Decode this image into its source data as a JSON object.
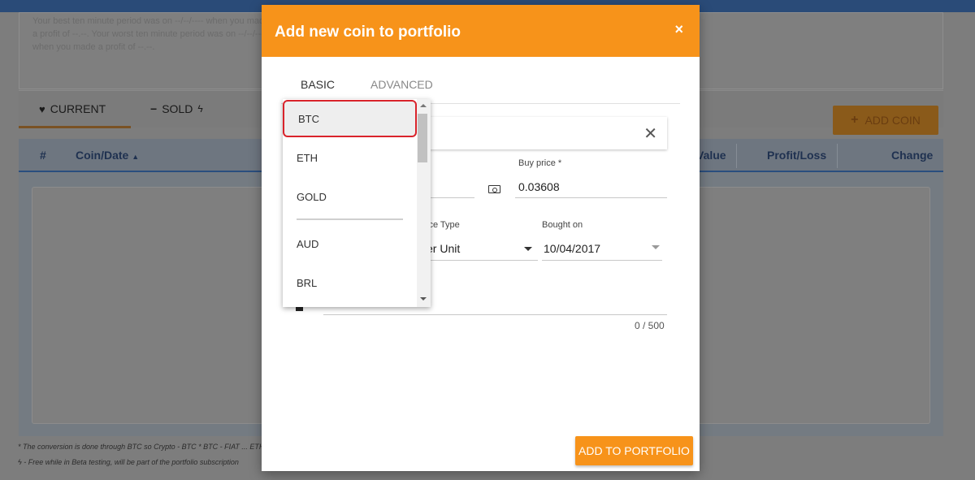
{
  "background": {
    "stats_text": "Your best ten minute period was on --/--/---- when you made a profit of --.--. Your worst ten minute period was on --/--/---- when you made a profit of --.--.",
    "tabs": {
      "current": "CURRENT",
      "sold": "SOLD"
    },
    "add_coin": "ADD COIN",
    "table_headers": [
      "#",
      "Coin/Date",
      "Value",
      "Profit/Loss",
      "Change"
    ],
    "footnote1": "* The conversion is done through BTC so Crypto - BTC * BTC - FIAT ... ETH is DASH - BTC / ETH - BTC)",
    "footnote2": "- Free while in Beta testing, will be part of the portfolio subscription"
  },
  "modal": {
    "title": "Add new coin to portfolio",
    "close": "×",
    "tabs": {
      "basic": "BASIC",
      "advanced": "ADVANCED"
    },
    "coin_clear": "✕",
    "buy_price_label": "Buy price *",
    "buy_price_value": "0.03608",
    "price_type_label": "ice Type",
    "price_type_value": "er Unit",
    "bought_on_label": "Bought on",
    "bought_on_value": "10/04/2017",
    "note_counter": "0 / 500",
    "submit": "ADD TO PORTFOLIO"
  },
  "dropdown": {
    "items": [
      "BTC",
      "ETH",
      "GOLD",
      "AUD",
      "BRL"
    ],
    "selected": "BTC"
  },
  "colors": {
    "accent": "#f7931a",
    "highlight_border": "#d9232b"
  }
}
